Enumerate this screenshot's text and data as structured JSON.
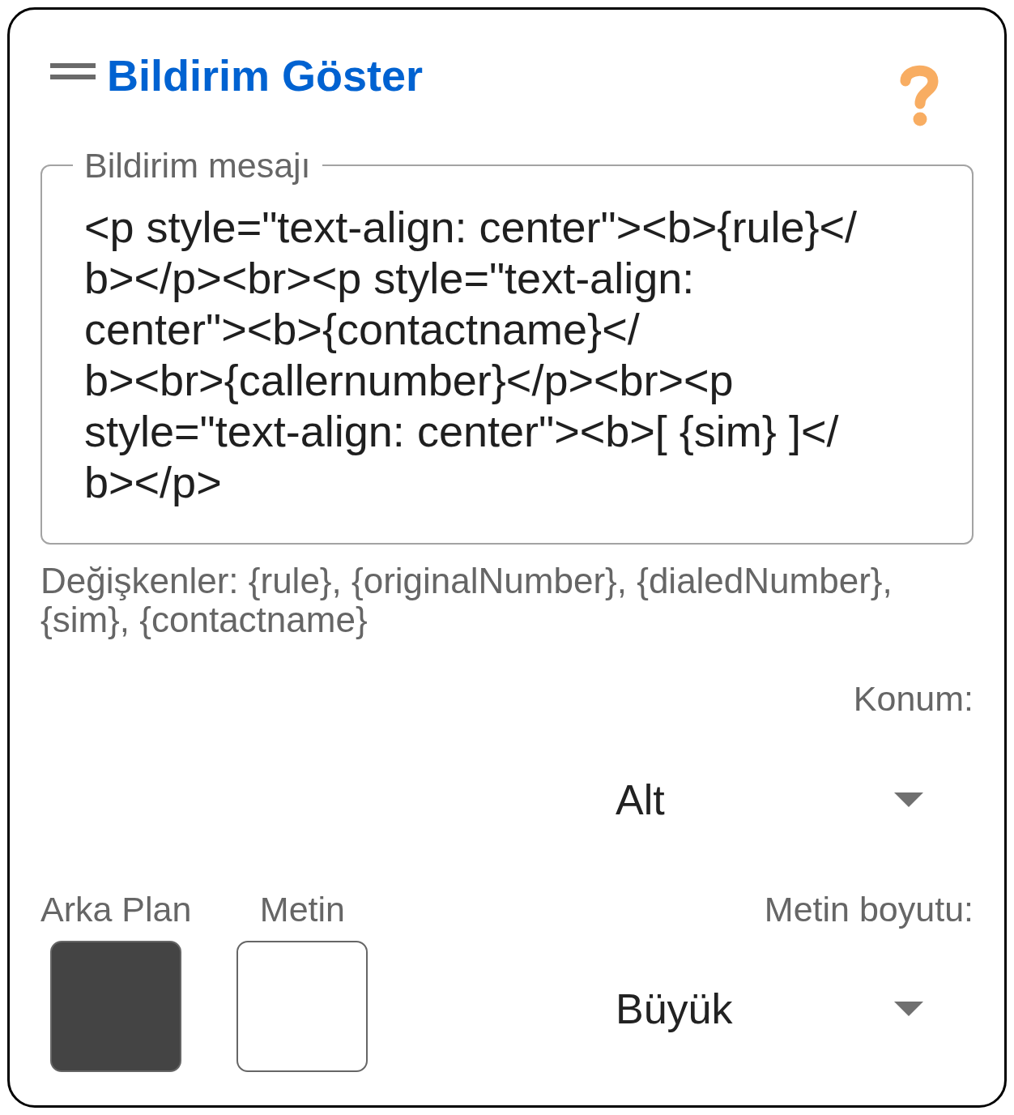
{
  "header": {
    "title": "Bildirim Göster"
  },
  "message": {
    "label": "Bildirim mesajı",
    "value": "<p style=\"text-align: center\"><b>{rule}</b></p><br><p style=\"text-align: center\"><b>{contactname}</b><br>{callernumber}</p><br><p style=\"text-align: center\"><b>[ {sim} ]</b></p>",
    "hint": "Değişkenler: {rule}, {originalNumber}, {dialedNumber}, {sim}, {contactname}"
  },
  "position": {
    "label": "Konum:",
    "value": "Alt"
  },
  "colors": [
    {
      "label": "Arka Plan",
      "color": "#444444"
    },
    {
      "label": "Metin",
      "color": "#ffffff"
    }
  ],
  "text_size": {
    "label": "Metin boyutu:",
    "value": "Büyük"
  }
}
